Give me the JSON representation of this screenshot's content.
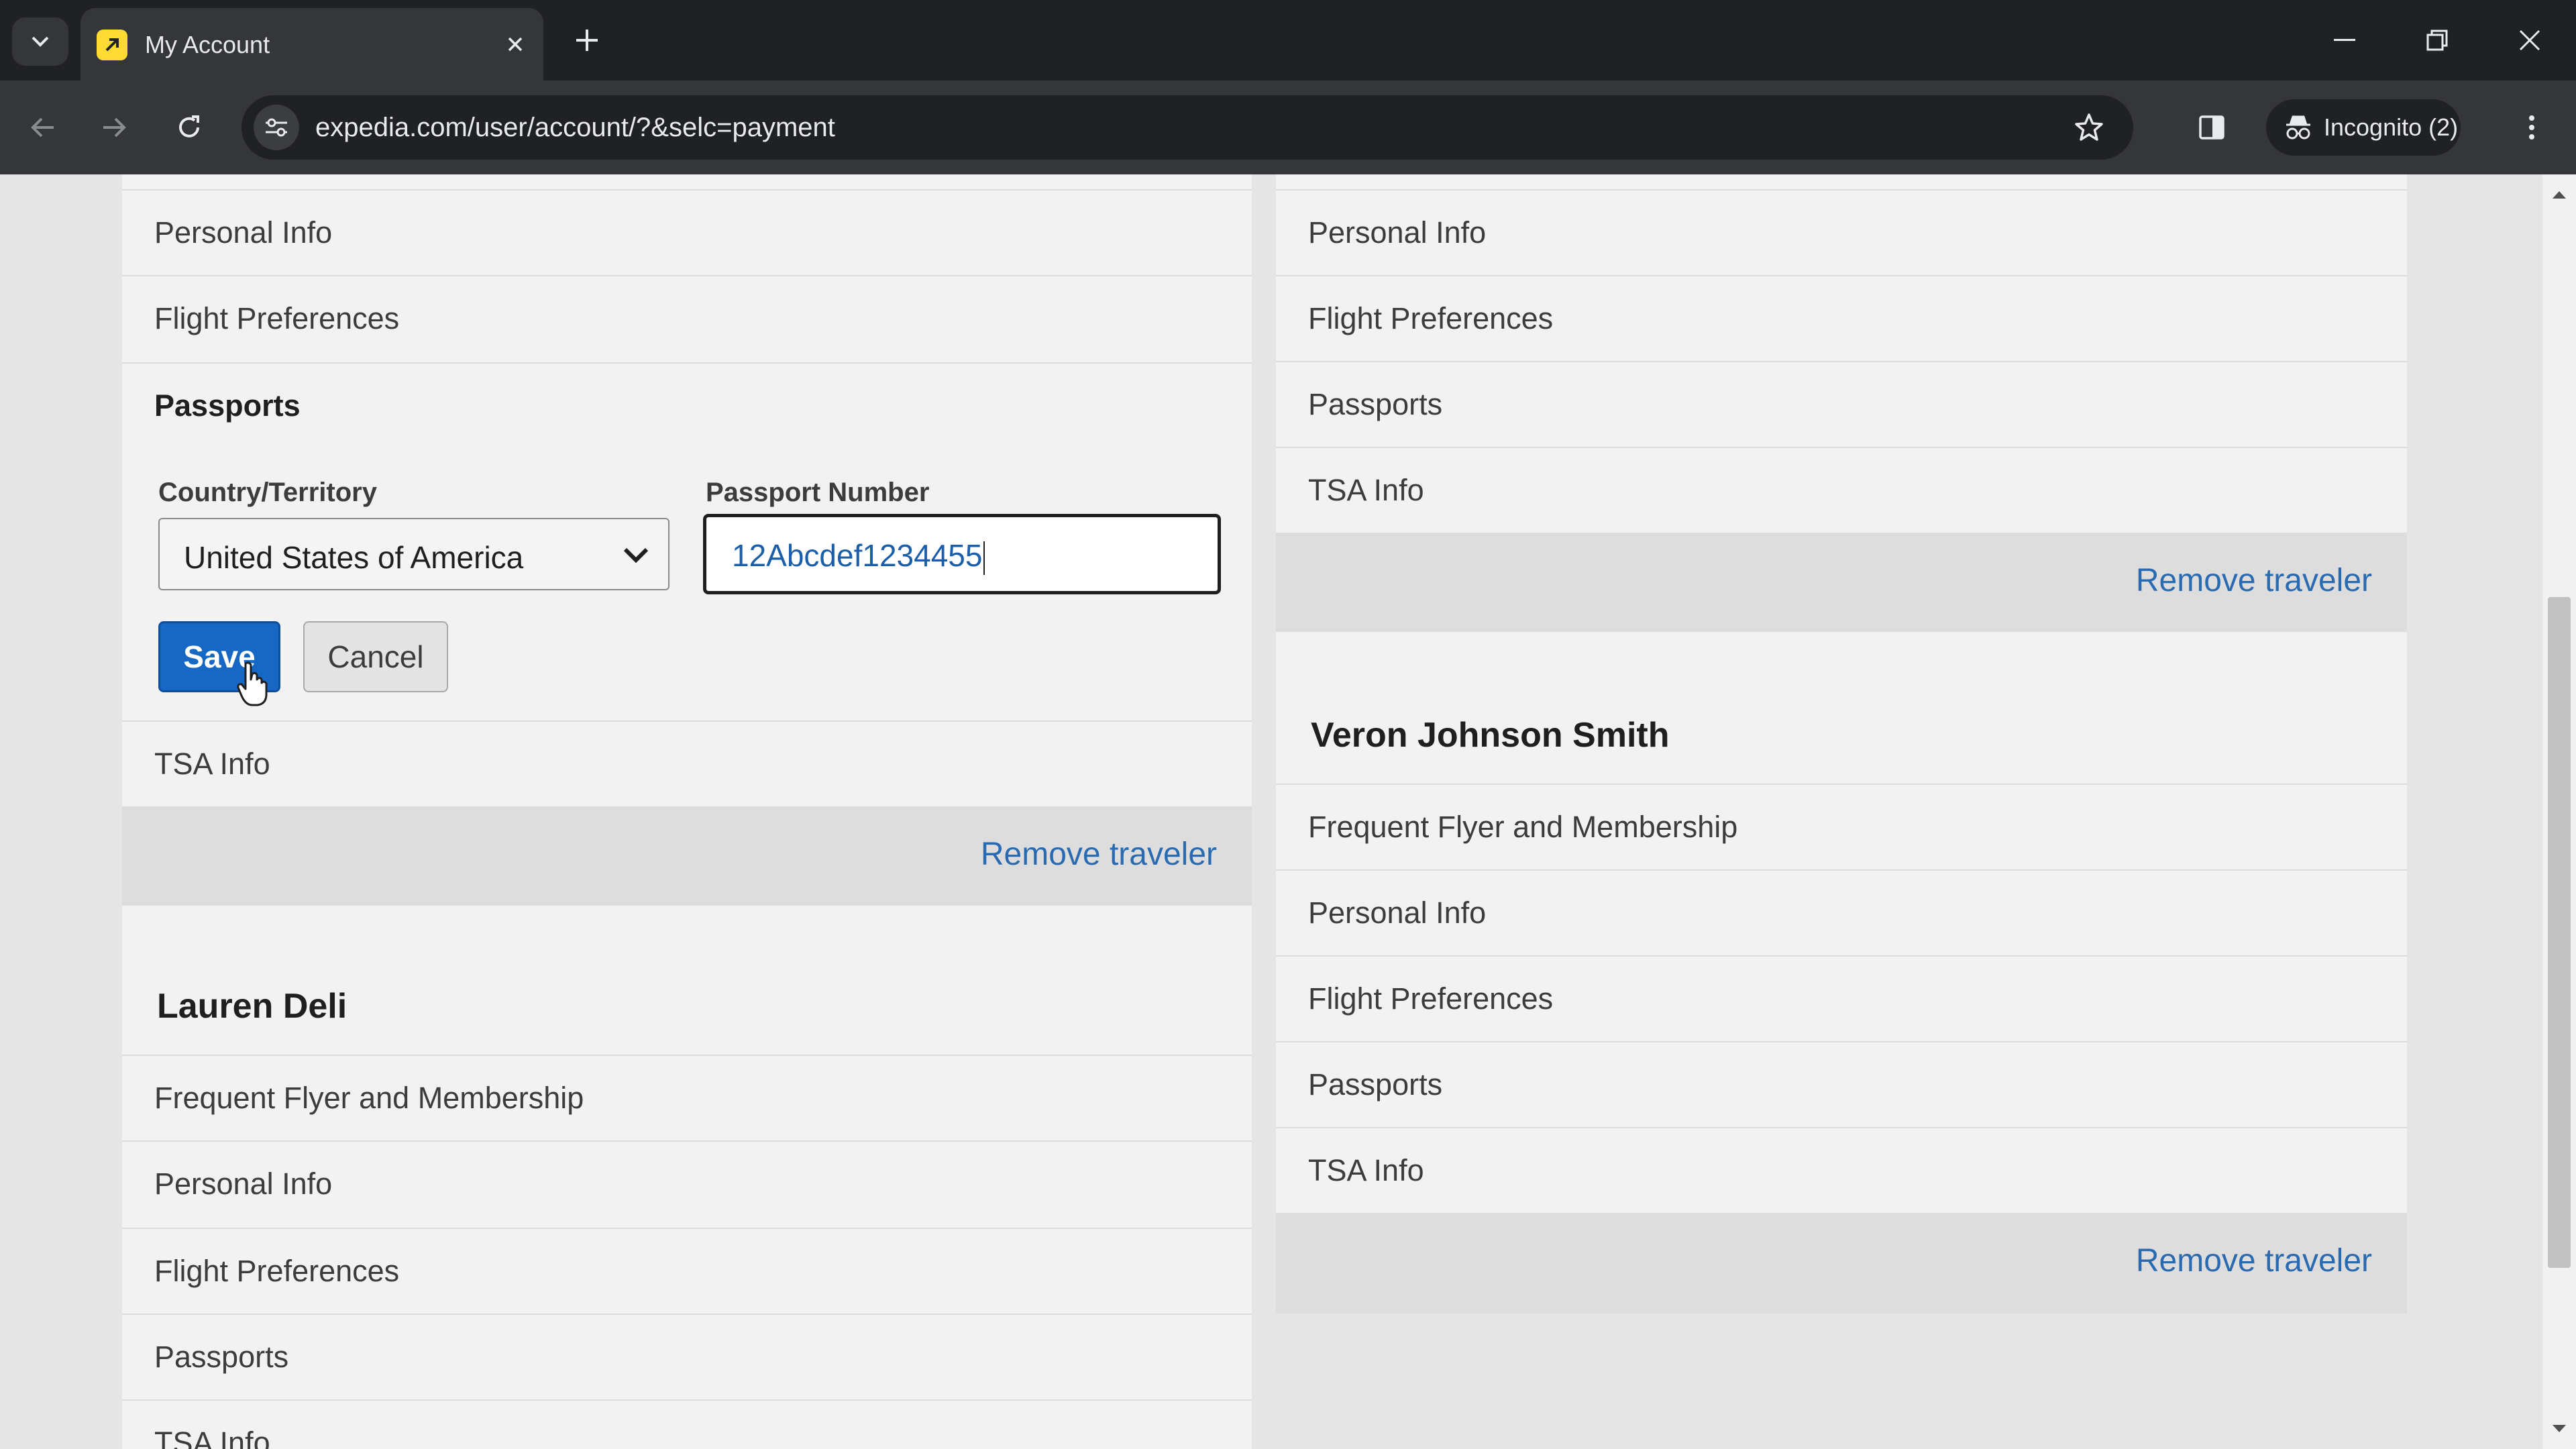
{
  "browser": {
    "tab_title": "My Account",
    "url": "expedia.com/user/account/?&selc=payment",
    "incognito_label": "Incognito (2)"
  },
  "left_card_1": {
    "rows": [
      "Personal Info",
      "Flight Preferences"
    ],
    "passports_heading": "Passports",
    "country_label": "Country/Territory",
    "country_value": "United States of America",
    "passport_label": "Passport Number",
    "passport_value": "12Abcdef1234455",
    "save_label": "Save",
    "cancel_label": "Cancel",
    "tsa_label": "TSA Info",
    "remove_label": "Remove traveler"
  },
  "left_card_2": {
    "name": "Lauren Deli",
    "rows": [
      "Frequent Flyer and Membership",
      "Personal Info",
      "Flight Preferences",
      "Passports",
      "TSA Info"
    ]
  },
  "right_card_1": {
    "rows": [
      "Personal Info",
      "Flight Preferences",
      "Passports",
      "TSA Info"
    ],
    "remove_label": "Remove traveler"
  },
  "right_card_2": {
    "name": "Veron Johnson Smith",
    "rows": [
      "Frequent Flyer and Membership",
      "Personal Info",
      "Flight Preferences",
      "Passports",
      "TSA Info"
    ],
    "remove_label": "Remove traveler"
  }
}
